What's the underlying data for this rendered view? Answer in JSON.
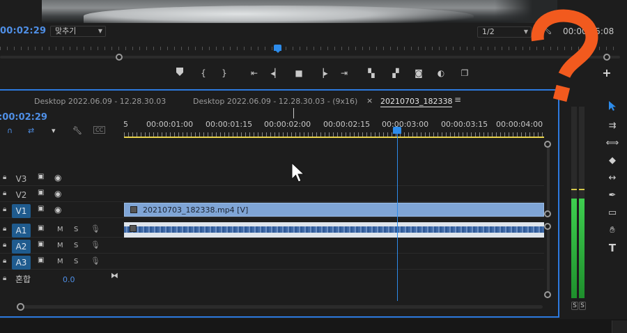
{
  "monitor": {
    "timecode": "00:02:29",
    "fit_label": "맞추기",
    "resolution": "1/2",
    "duration": "00:00:25:08",
    "buttons": [
      "marker",
      "in-point",
      "out-point",
      "go-to-in",
      "step-back",
      "stop",
      "step-forward",
      "go-to-out",
      "lift",
      "extract",
      "export-frame",
      "compare",
      "overlay"
    ]
  },
  "tabs": [
    {
      "label": "Desktop 2022.06.09 - 12.28.30.03"
    },
    {
      "label": "Desktop 2022.06.09 - 12.28.30.03 - (9x16)"
    },
    {
      "label": "20210703_182338"
    }
  ],
  "timeline": {
    "timecode": "00:00:02:29",
    "ruler_labels": [
      "5",
      "00:00:01:00",
      "00:00:01:15",
      "00:00:02:00",
      "00:00:02:15",
      "00:00:03:00",
      "00:00:03:15",
      "00:00:04:00"
    ],
    "tracks": [
      {
        "name": "V3",
        "kind": "video",
        "targeted": false
      },
      {
        "name": "V2",
        "kind": "video",
        "targeted": false
      },
      {
        "name": "V1",
        "kind": "video",
        "targeted": true
      },
      {
        "name": "A1",
        "kind": "audio",
        "targeted": true
      },
      {
        "name": "A2",
        "kind": "audio",
        "targeted": true
      },
      {
        "name": "A3",
        "kind": "audio",
        "targeted": true
      }
    ],
    "mute_label": "M",
    "solo_label": "S",
    "mix": {
      "label": "혼합",
      "value": "0.0"
    },
    "video_clip": {
      "label": "20210703_182338.mp4 [V]"
    },
    "playhead_time": "00:00:03:00"
  },
  "meters": {
    "left_level": 0.52,
    "right_level": 0.52,
    "solo_labels": [
      "S",
      "S"
    ],
    "colors": {
      "fill": "#3ecf4f",
      "peak": "#d4c84a"
    }
  },
  "tools": [
    "selection-tool",
    "track-select-tool",
    "ripple-edit-tool",
    "razor-tool",
    "slip-tool",
    "pen-tool",
    "rectangle-tool",
    "hand-tool",
    "type-tool"
  ],
  "overlay": {
    "question_mark_color": "#f25a1e"
  },
  "colors": {
    "accent": "#2d8ceb",
    "timecode": "#4f8fe6",
    "panel_border": "#2d7ae0",
    "clip_video": "#7fa5d6"
  }
}
